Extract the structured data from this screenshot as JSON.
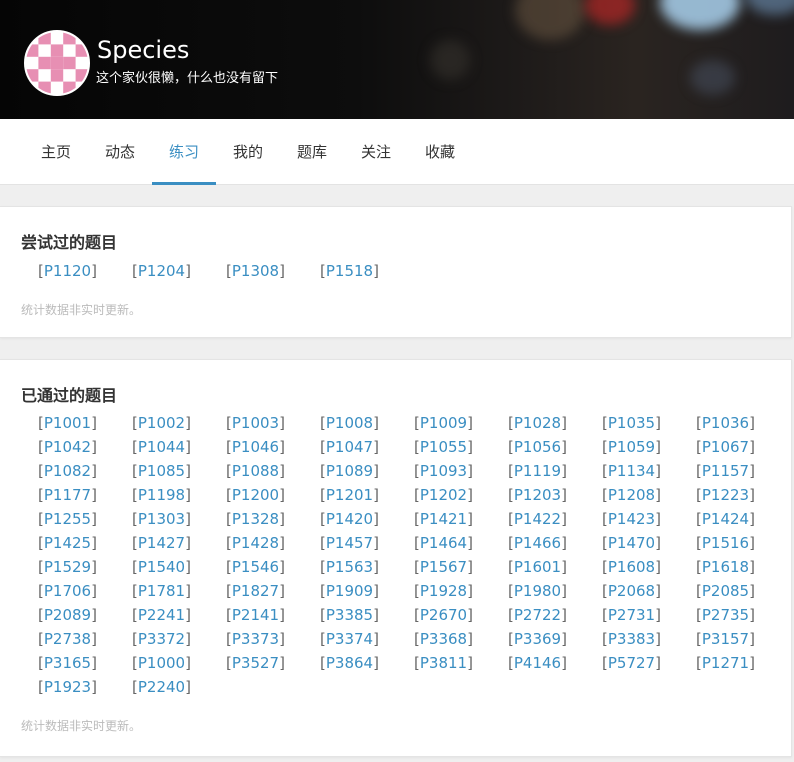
{
  "profile": {
    "name": "Species",
    "bio": "这个家伙很懒，什么也没有留下"
  },
  "tabs": [
    {
      "label": "主页"
    },
    {
      "label": "动态"
    },
    {
      "label": "练习"
    },
    {
      "label": "我的"
    },
    {
      "label": "题库"
    },
    {
      "label": "关注"
    },
    {
      "label": "收藏"
    }
  ],
  "active_tab": "练习",
  "colors": {
    "accent": "#3a8ec2",
    "avatar_pink": "#e78fb3"
  },
  "attempted": {
    "title": "尝试过的题目",
    "problems": [
      "P1120",
      "P1204",
      "P1308",
      "P1518"
    ],
    "note": "统计数据非实时更新。"
  },
  "passed": {
    "title": "已通过的题目",
    "problems": [
      "P1001",
      "P1002",
      "P1003",
      "P1008",
      "P1009",
      "P1028",
      "P1035",
      "P1036",
      "P1042",
      "P1044",
      "P1046",
      "P1047",
      "P1055",
      "P1056",
      "P1059",
      "P1067",
      "P1082",
      "P1085",
      "P1088",
      "P1089",
      "P1093",
      "P1119",
      "P1134",
      "P1157",
      "P1177",
      "P1198",
      "P1200",
      "P1201",
      "P1202",
      "P1203",
      "P1208",
      "P1223",
      "P1255",
      "P1303",
      "P1328",
      "P1420",
      "P1421",
      "P1422",
      "P1423",
      "P1424",
      "P1425",
      "P1427",
      "P1428",
      "P1457",
      "P1464",
      "P1466",
      "P1470",
      "P1516",
      "P1529",
      "P1540",
      "P1546",
      "P1563",
      "P1567",
      "P1601",
      "P1608",
      "P1618",
      "P1706",
      "P1781",
      "P1827",
      "P1909",
      "P1928",
      "P1980",
      "P2068",
      "P2085",
      "P2089",
      "P2241",
      "P2141",
      "P3385",
      "P2670",
      "P2722",
      "P2731",
      "P2735",
      "P2738",
      "P3372",
      "P3373",
      "P3374",
      "P3368",
      "P3369",
      "P3383",
      "P3157",
      "P3165",
      "P1000",
      "P3527",
      "P3864",
      "P3811",
      "P4146",
      "P5727",
      "P1271",
      "P1923",
      "P2240"
    ],
    "note": "统计数据非实时更新。"
  }
}
